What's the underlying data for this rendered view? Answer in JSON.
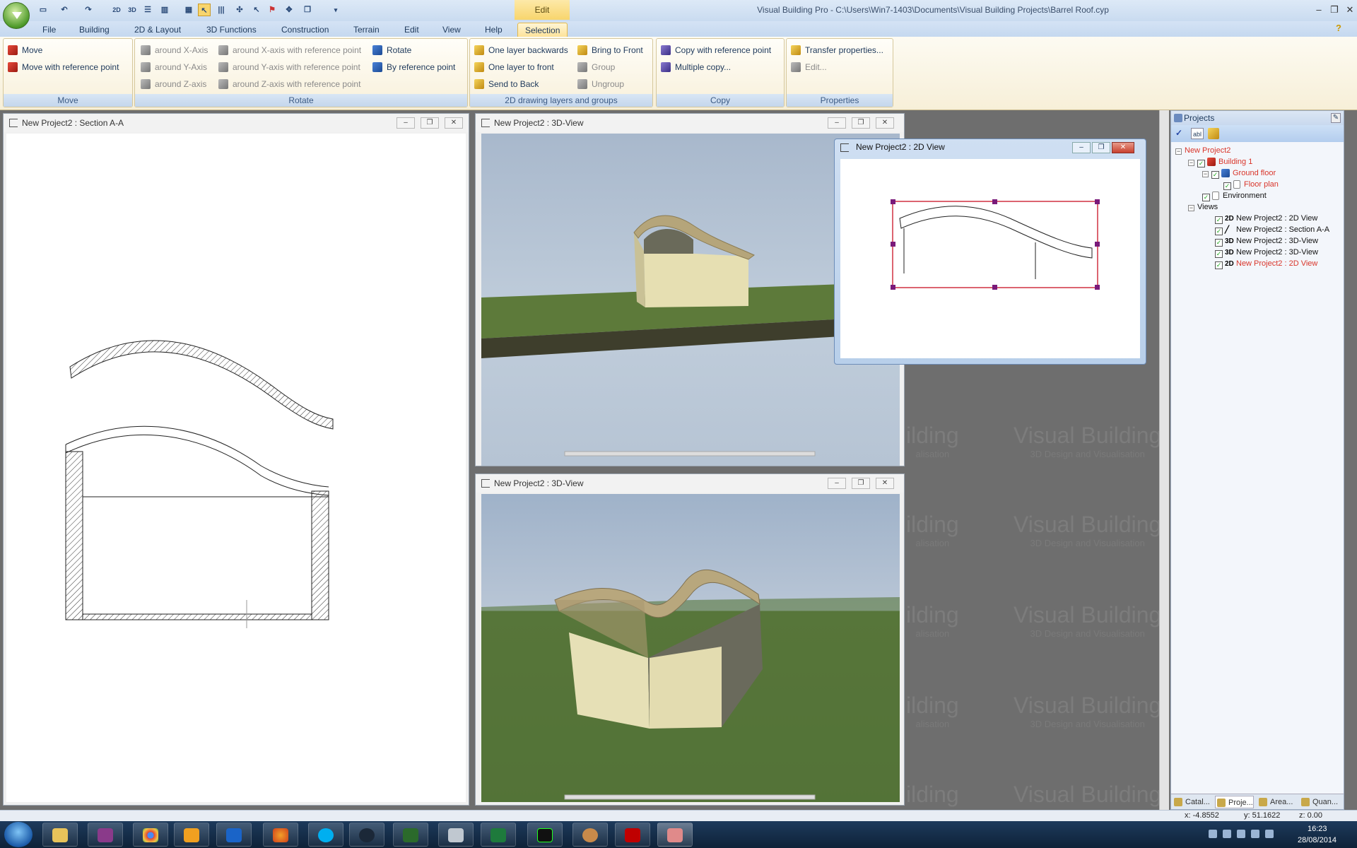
{
  "app": {
    "window_title": "Visual Building Pro - C:\\Users\\Win7-1403\\Documents\\Visual Building Projects\\Barrel Roof.cyp",
    "context_tab_group": "Edit",
    "help_icon": "?"
  },
  "tabs": [
    "File",
    "Building",
    "2D & Layout",
    "3D Functions",
    "Construction",
    "Terrain",
    "Edit",
    "View",
    "Help",
    "Selection"
  ],
  "ribbon": {
    "move": {
      "label": "Move",
      "items": [
        "Move",
        "Move with reference point"
      ]
    },
    "rotate": {
      "label": "Rotate",
      "axis": [
        "around X-Axis",
        "around Y-Axis",
        "around Z-axis"
      ],
      "ref": [
        "around X-axis with reference point",
        "around Y-axis with reference point",
        "around Z-axis with reference point"
      ],
      "misc": [
        "Rotate",
        "By reference point"
      ]
    },
    "layers": {
      "label": "2D drawing layers and groups",
      "col1": [
        "One layer backwards",
        "One layer to front",
        "Send to Back"
      ],
      "col2": [
        "Bring to Front",
        "Group",
        "Ungroup"
      ]
    },
    "copy": {
      "label": "Copy",
      "items": [
        "Copy with reference point",
        "Multiple copy..."
      ]
    },
    "properties": {
      "label": "Properties",
      "items": [
        "Transfer properties...",
        "Edit..."
      ]
    }
  },
  "windows": {
    "section": "New Project2 : Section A-A",
    "view3d_top": "New Project2 : 3D-View",
    "view3d_bottom": "New Project2 : 3D-View",
    "view2d": "New Project2 : 2D View"
  },
  "watermark": {
    "title": "Visual Building",
    "subtitle": "3D Design and Visualisation",
    "partial_title": "ilding",
    "partial_subtitle": "alisation"
  },
  "projects": {
    "title": "Projects",
    "tree": {
      "root": "New Project2",
      "building": "Building 1",
      "floor": "Ground floor",
      "plan": "Floor plan",
      "environment": "Environment",
      "views_label": "Views",
      "views": [
        {
          "tag": "2D",
          "name": "New Project2 : 2D View",
          "red": false
        },
        {
          "tag": "",
          "name": "New Project2 : Section A-A",
          "red": false
        },
        {
          "tag": "3D",
          "name": "New Project2 : 3D-View",
          "red": false
        },
        {
          "tag": "3D",
          "name": "New Project2 : 3D-View",
          "red": false
        },
        {
          "tag": "2D",
          "name": "New Project2 : 2D View",
          "red": true
        }
      ]
    },
    "bottom_tabs": [
      "Catal...",
      "Proje...",
      "Area...",
      "Quan..."
    ]
  },
  "status": {
    "x": "x: -4.8552",
    "y": "y: 51.1622",
    "z": "z: 0.00"
  },
  "tray": {
    "time": "16:23",
    "date": "28/08/2014"
  },
  "icons": [
    "app-menu-icon",
    "new-icon",
    "undo-icon",
    "redo-icon",
    "view2d-icon",
    "view3d-icon",
    "grid-icon",
    "select-icon",
    "help-icon",
    "start-icon",
    "explorer-icon",
    "chrome-icon",
    "media-icon",
    "outlook-icon",
    "firefox-icon",
    "skype-icon",
    "steam-icon",
    "excel-icon",
    "filezilla-icon"
  ]
}
